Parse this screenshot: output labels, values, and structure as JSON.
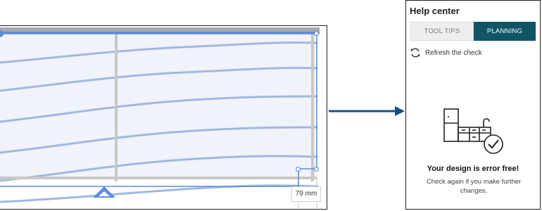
{
  "canvas": {
    "dimension_label": "79 mm",
    "accent_color": "#5b8dd9",
    "wave_color": "#9fb8e0"
  },
  "help_center": {
    "title": "Help center",
    "tabs": [
      {
        "label": "TOOL TIPS",
        "active": false
      },
      {
        "label": "PLANNING",
        "active": true
      }
    ],
    "refresh_label": "Refresh the check",
    "status_title": "Your design is error free!",
    "status_subtitle": "Check again if you make further changes.",
    "active_tab_color": "#0f5566"
  },
  "arrow_color": "#1b4f7f",
  "icons": [
    "refresh-icon",
    "kitchen-check-icon",
    "collapse-arrow-icon"
  ]
}
